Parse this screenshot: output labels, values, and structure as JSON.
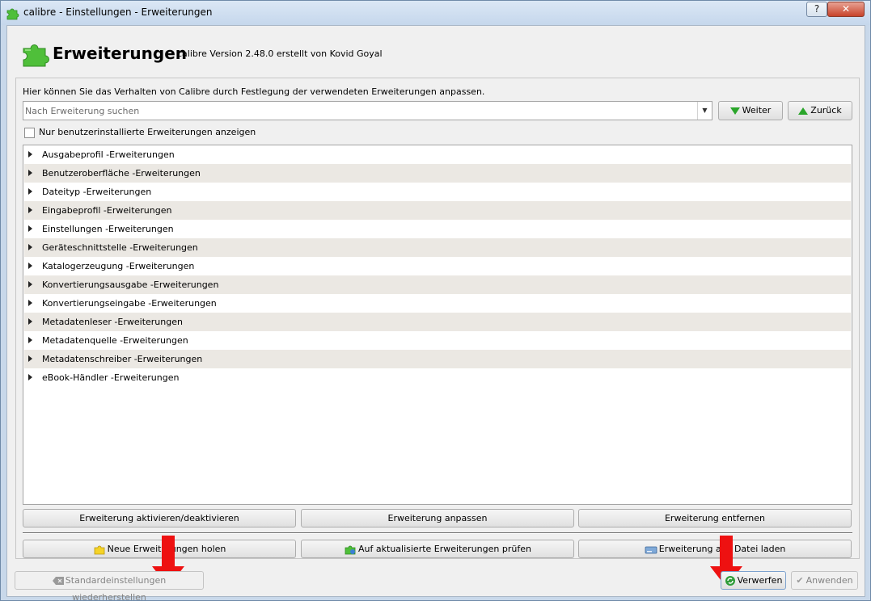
{
  "window": {
    "title": "calibre - Einstellungen - Erweiterungen",
    "help_label": "?",
    "close_label": "✕"
  },
  "header": {
    "title": "Erweiterungen",
    "subtitle": "calibre Version 2.48.0 erstellt von Kovid Goyal"
  },
  "panel": {
    "description": "Hier können Sie das Verhalten von Calibre durch Festlegung der verwendeten Erweiterungen anpassen.",
    "search_placeholder": "Nach Erweiterung suchen",
    "next_label": "Weiter",
    "back_label": "Zurück",
    "user_only_label": "Nur benutzerinstallierte Erweiterungen anzeigen"
  },
  "tree": {
    "items": [
      "Ausgabeprofil -Erweiterungen",
      "Benutzeroberfläche -Erweiterungen",
      "Dateityp -Erweiterungen",
      "Eingabeprofil -Erweiterungen",
      "Einstellungen -Erweiterungen",
      "Geräteschnittstelle -Erweiterungen",
      "Katalogerzeugung -Erweiterungen",
      "Konvertierungsausgabe -Erweiterungen",
      "Konvertierungseingabe -Erweiterungen",
      "Metadatenleser -Erweiterungen",
      "Metadatenquelle -Erweiterungen",
      "Metadatenschreiber -Erweiterungen",
      "eBook-Händler -Erweiterungen"
    ]
  },
  "actions": {
    "toggle_label": "Erweiterung aktivieren/deaktivieren",
    "customize_label": "Erweiterung anpassen",
    "remove_label": "Erweiterung entfernen",
    "get_new_label": "Neue Erweiterungen holen",
    "check_updates_label": "Auf aktualisierte Erweiterungen prüfen",
    "load_file_label": "Erweiterung aus Datei laden"
  },
  "footer": {
    "reset_label": "Standardeinstellungen wiederherstellen",
    "discard_label": "Verwerfen",
    "apply_label": "Anwenden"
  },
  "colors": {
    "annotation_arrow": "#ee1111",
    "puzzle_green": "#4fbf3a",
    "row_alt": "#ebe8e3"
  }
}
